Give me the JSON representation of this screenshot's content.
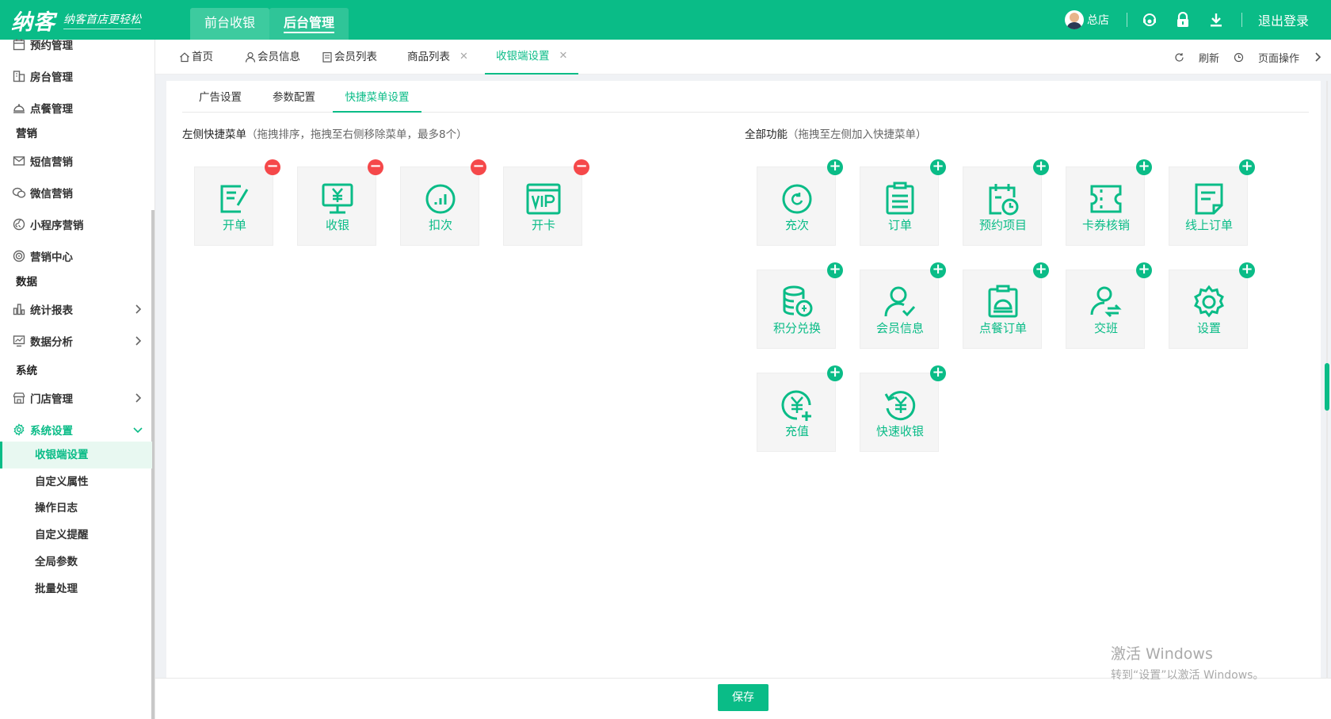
{
  "header": {
    "logo": "纳客",
    "slogan": "纳客首店更轻松",
    "tabs": [
      {
        "label": "前台收银"
      },
      {
        "label": "后台管理"
      }
    ],
    "user_name": "总店",
    "logout_label": "退出登录"
  },
  "sidebar": {
    "items": [
      {
        "label": "预约管理",
        "icon": "calendar-icon"
      },
      {
        "label": "房台管理",
        "icon": "building-icon"
      },
      {
        "label": "点餐管理",
        "icon": "dish-icon"
      }
    ],
    "cat_marketing": "营销",
    "marketing_items": [
      {
        "label": "短信营销",
        "icon": "mail-icon"
      },
      {
        "label": "微信营销",
        "icon": "wechat-icon"
      },
      {
        "label": "小程序营销",
        "icon": "miniprogram-icon"
      },
      {
        "label": "营销中心",
        "icon": "target-icon"
      }
    ],
    "cat_data": "数据",
    "data_items": [
      {
        "label": "统计报表",
        "icon": "bar-chart-icon"
      },
      {
        "label": "数据分析",
        "icon": "monitor-chart-icon"
      }
    ],
    "cat_system": "系统",
    "system_items": [
      {
        "label": "门店管理",
        "icon": "store-icon"
      },
      {
        "label": "系统设置",
        "icon": "gear-icon"
      }
    ],
    "sub_items": [
      {
        "label": "收银端设置"
      },
      {
        "label": "自定义属性"
      },
      {
        "label": "操作日志"
      },
      {
        "label": "自定义提醒"
      },
      {
        "label": "全局参数"
      },
      {
        "label": "批量处理"
      }
    ]
  },
  "page_tabs": [
    {
      "label": "首页"
    },
    {
      "label": "会员信息"
    },
    {
      "label": "会员列表"
    },
    {
      "label": "商品列表"
    },
    {
      "label": "收银端设置"
    }
  ],
  "tab_actions": {
    "refresh": "刷新",
    "page_ops": "页面操作"
  },
  "inner_tabs": [
    {
      "label": "广告设置"
    },
    {
      "label": "参数配置"
    },
    {
      "label": "快捷菜单设置"
    }
  ],
  "left_section": {
    "title": "左侧快捷菜单",
    "hint": "（拖拽排序，拖拽至右侧移除菜单，最多8个）",
    "tiles": [
      {
        "label": "开单",
        "icon": "edit-doc-icon"
      },
      {
        "label": "收银",
        "icon": "monitor-yen-icon"
      },
      {
        "label": "扣次",
        "icon": "chart-circle-icon"
      },
      {
        "label": "开卡",
        "icon": "vip-card-icon"
      }
    ]
  },
  "right_section": {
    "title": "全部功能",
    "hint": "（拖拽至左侧加入快捷菜单）",
    "tiles": [
      {
        "label": "充次",
        "icon": "refresh-circle-icon"
      },
      {
        "label": "订单",
        "icon": "clipboard-icon"
      },
      {
        "label": "预约项目",
        "icon": "calendar-clock-icon"
      },
      {
        "label": "卡券核销",
        "icon": "ticket-icon"
      },
      {
        "label": "线上订单",
        "icon": "doc-icon"
      },
      {
        "label": "积分兑换",
        "icon": "coins-icon"
      },
      {
        "label": "会员信息",
        "icon": "user-check-icon"
      },
      {
        "label": "点餐订单",
        "icon": "dish-order-icon"
      },
      {
        "label": "交班",
        "icon": "user-handover-icon"
      },
      {
        "label": "设置",
        "icon": "gear-icon"
      },
      {
        "label": "充值",
        "icon": "yen-plus-icon"
      },
      {
        "label": "快速收银",
        "icon": "yen-refresh-icon"
      }
    ]
  },
  "footer": {
    "save_label": "保存"
  },
  "watermark": {
    "line1": "激活 Windows",
    "line2": "转到“设置”以激活 Windows。"
  },
  "colors": {
    "brand": "#0abc87",
    "remove": "#f5484a"
  }
}
